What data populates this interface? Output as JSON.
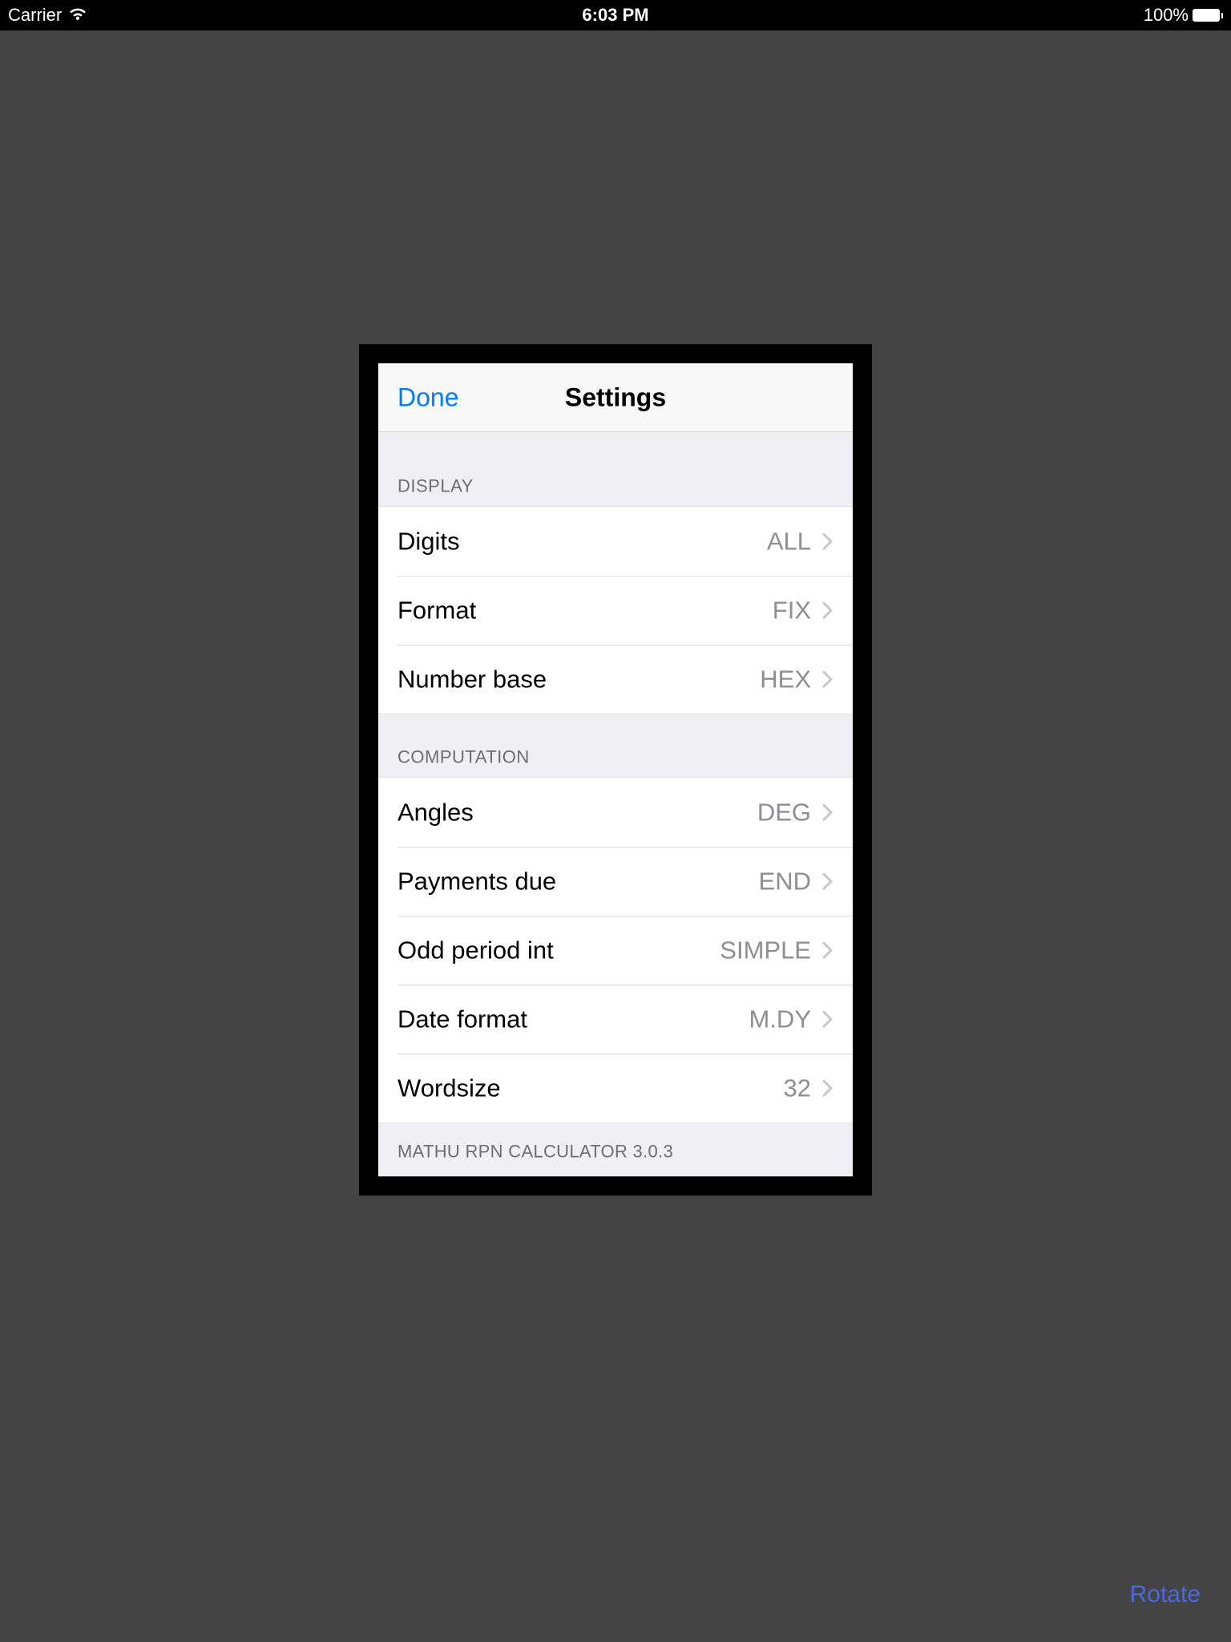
{
  "statusBar": {
    "carrier": "Carrier",
    "time": "6:03 PM",
    "batteryPercent": "100%"
  },
  "nav": {
    "done": "Done",
    "title": "Settings"
  },
  "sections": {
    "display": {
      "header": "DISPLAY",
      "rows": [
        {
          "label": "Digits",
          "value": "ALL"
        },
        {
          "label": "Format",
          "value": "FIX"
        },
        {
          "label": "Number base",
          "value": "HEX"
        }
      ]
    },
    "computation": {
      "header": "COMPUTATION",
      "rows": [
        {
          "label": "Angles",
          "value": "DEG"
        },
        {
          "label": "Payments due",
          "value": "END"
        },
        {
          "label": "Odd period int",
          "value": "SIMPLE"
        },
        {
          "label": "Date format",
          "value": "M.DY"
        },
        {
          "label": "Wordsize",
          "value": "32"
        }
      ]
    }
  },
  "footer": "MATHU RPN CALCULATOR 3.0.3",
  "rotate": "Rotate"
}
